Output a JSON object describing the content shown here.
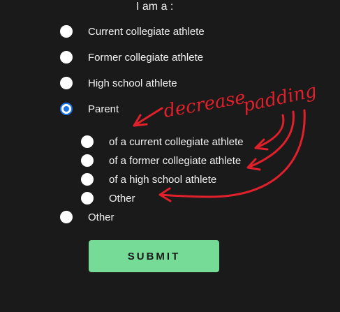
{
  "form": {
    "title": "I am a :",
    "options": [
      {
        "label": "Current collegiate athlete",
        "checked": false
      },
      {
        "label": "Former collegiate athlete",
        "checked": false
      },
      {
        "label": "High school athlete",
        "checked": false
      },
      {
        "label": "Parent",
        "checked": true
      }
    ],
    "sub_options": [
      {
        "label": "of a current collegiate athlete",
        "checked": false
      },
      {
        "label": "of a former collegiate athlete",
        "checked": false
      },
      {
        "label": "of a high school athlete",
        "checked": false
      },
      {
        "label": "Other",
        "checked": false
      }
    ],
    "other": {
      "label": "Other",
      "checked": false
    },
    "submit_label": "SUBMIT"
  },
  "annotation": {
    "word1": "decrease",
    "word2": "padding",
    "color": "#e0202a"
  },
  "colors": {
    "background": "#1b1a1a",
    "accent": "#1a73e8",
    "submit_bg": "#76db96"
  }
}
